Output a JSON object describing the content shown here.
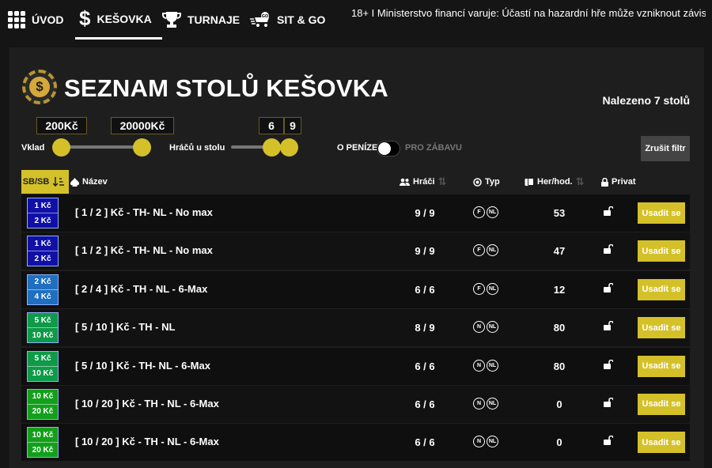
{
  "nav": {
    "items": [
      {
        "label": "ÚVOD",
        "icon": "grid-icon"
      },
      {
        "label": "KEŠOVKA",
        "icon": "dollar-icon",
        "active": true
      },
      {
        "label": "TURNAJE",
        "icon": "trophy-icon"
      },
      {
        "label": "SIT & GO",
        "icon": "go-icon"
      }
    ],
    "warning": "18+ I Ministerstvo financí varuje: Účastí na hazardní hře může vzniknout závislost."
  },
  "header": {
    "title": "SEZNAM STOLŮ KEŠOVKA",
    "coin_symbol": "$",
    "found": "Nalezeno 7 stolů"
  },
  "filters": {
    "stake_label": "Vklad",
    "stake_min": "200Kč",
    "stake_max": "20000Kč",
    "players_label": "Hráčů u stolu",
    "players_min": "6",
    "players_max": "9",
    "money_label": "O PENÍZE",
    "fun_label": "PRO ZÁBAVU",
    "reset_label": "Zrušit filtr"
  },
  "table": {
    "headers": {
      "sb": "SB/SB",
      "name": "Název",
      "players": "Hráči",
      "type": "Typ",
      "hands": "Her/hod.",
      "private": "Privat"
    },
    "rows": [
      {
        "sb": "1 Kč",
        "bb": "2 Kč",
        "color": "#1010a8",
        "name": "[ 1 / 2 ] Kč - TH- NL - No max",
        "players": "9 / 9",
        "t1": "F",
        "t2": "NL",
        "hands": "53",
        "sit": "Usadit se"
      },
      {
        "sb": "1 Kč",
        "bb": "2 Kč",
        "color": "#1010a8",
        "name": "[ 1 / 2 ] Kč - TH- NL - No max",
        "players": "9 / 9",
        "t1": "F",
        "t2": "NL",
        "hands": "47",
        "sit": "Usadit se"
      },
      {
        "sb": "2 Kč",
        "bb": "4 Kč",
        "color": "#1e6fc0",
        "name": "[ 2 / 4 ] Kč - TH - NL - 6-Max",
        "players": "6 / 6",
        "t1": "F",
        "t2": "NL",
        "hands": "12",
        "sit": "Usadit se"
      },
      {
        "sb": "5 Kč",
        "bb": "10 Kč",
        "color": "#0e9a48",
        "name": "[ 5 / 10 ] Kč - TH - NL",
        "players": "8 / 9",
        "t1": "N",
        "t2": "NL",
        "hands": "80",
        "sit": "Usadit se"
      },
      {
        "sb": "5 Kč",
        "bb": "10 Kč",
        "color": "#0e9a48",
        "name": "[ 5 / 10 ] Kč - TH- NL - 6-Max",
        "players": "6 / 6",
        "t1": "N",
        "t2": "NL",
        "hands": "80",
        "sit": "Usadit se"
      },
      {
        "sb": "10 Kč",
        "bb": "20 Kč",
        "color": "#12a01a",
        "name": "[ 10 / 20 ] Kč - TH - NL - 6-Max",
        "players": "6 / 6",
        "t1": "N",
        "t2": "NL",
        "hands": "0",
        "sit": "Usadit se"
      },
      {
        "sb": "10 Kč",
        "bb": "20 Kč",
        "color": "#12a01a",
        "name": "[ 10 / 20 ] Kč - TH - NL - 6-Max",
        "players": "6 / 6",
        "t1": "N",
        "t2": "NL",
        "hands": "0",
        "sit": "Usadit se"
      }
    ]
  }
}
